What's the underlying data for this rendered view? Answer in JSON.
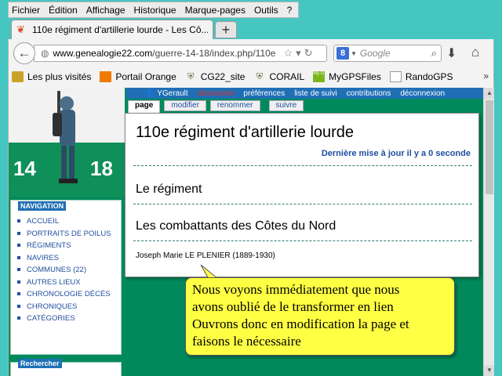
{
  "menubar": {
    "items": [
      "Fichier",
      "Édition",
      "Affichage",
      "Historique",
      "Marque-pages",
      "Outils",
      "?"
    ]
  },
  "tab": {
    "title": "110e régiment d'artillerie lourde - Les Cô...",
    "new_tab_label": "+"
  },
  "urlbar": {
    "domain": "www.genealogie22.com",
    "path": "/guerre-14-18/index.php/110e"
  },
  "searchbar": {
    "placeholder": "Google",
    "engine_letter": "8"
  },
  "bookmarks": [
    {
      "label": "Les plus visités",
      "icon": "bookmark-folder-icon",
      "color": "#c9a227"
    },
    {
      "label": "Portail Orange",
      "icon": "orange-logo-icon",
      "color": "#f07a00"
    },
    {
      "label": "CG22_site",
      "icon": "coat-of-arms-icon",
      "color": "#556b2f"
    },
    {
      "label": "CORAIL",
      "icon": "coat-of-arms-icon",
      "color": "#556b2f"
    },
    {
      "label": "MyGPSFiles",
      "icon": "mygps-logo-icon",
      "color": "#7ab51d",
      "logo_text": "My GPS"
    },
    {
      "label": "RandoGPS",
      "icon": "blank-page-icon",
      "color": "#ffffff"
    }
  ],
  "site": {
    "logo_numbers": [
      "14",
      "18"
    ],
    "topbar": {
      "user": "YGerault",
      "discussion": "discussion",
      "links": [
        "préférences",
        "liste de suivi",
        "contributions",
        "déconnexion"
      ]
    },
    "page_tabs": [
      "page",
      "modifier",
      "renommer",
      "suivre"
    ],
    "navigation": {
      "heading": "NAVIGATION",
      "items": [
        {
          "label": "ACCUEIL"
        },
        {
          "label": "PORTRAITS DE POILUS"
        },
        {
          "label": "RÉGIMENTS"
        },
        {
          "label": "NAVIRES"
        },
        {
          "label": "COMMUNES (22)"
        },
        {
          "label": "AUTRES LIEUX"
        },
        {
          "label": "CHRONOLOGIE DÉCÈS"
        },
        {
          "label": "CHRONIQUES"
        },
        {
          "label": "CATÉGORIES"
        }
      ]
    },
    "search_heading": "Rechercher"
  },
  "content": {
    "title": "110e régiment d'artillerie lourde",
    "last_update": "Dernière mise à jour il y a 0 seconde",
    "section1": "Le régiment",
    "section2": "Les combattants des Côtes du Nord",
    "person": "Joseph Marie LE PLENIER (1889-1930)"
  },
  "callout": {
    "lines": [
      "Nous voyons immédiatement que nous",
      "avons oublié de le transformer en lien",
      "Ouvrons donc en modification la page et",
      "faisons le nécessaire"
    ],
    "fill": "#ffff44"
  }
}
